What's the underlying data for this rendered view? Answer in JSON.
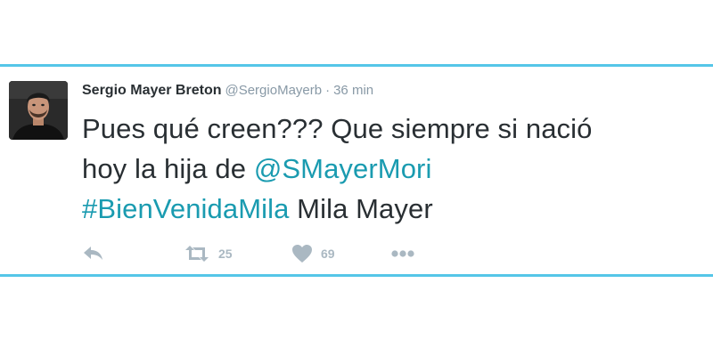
{
  "tweet": {
    "author": {
      "name": "Sergio Mayer Breton",
      "handle": "@SergioMayerb",
      "separator": "·",
      "time": "36 min"
    },
    "text": {
      "line1": "Pues qué creen??? Que siempre si nació",
      "line2_prefix": "hoy la hija de ",
      "mention": "@SMayerMori",
      "hashtag": "#BienVenidaMila",
      "line3_suffix": " Mila Mayer"
    },
    "actions": {
      "reply_icon": "reply-icon",
      "retweet_icon": "retweet-icon",
      "retweet_count": "25",
      "like_icon": "heart-icon",
      "like_count": "69",
      "more_icon": "more-dots-icon"
    },
    "colors": {
      "accent_rule": "#55c6e8",
      "link": "#1a9bb0",
      "text": "#292f33",
      "muted": "#8899a6",
      "icon": "#aab8c2"
    }
  }
}
